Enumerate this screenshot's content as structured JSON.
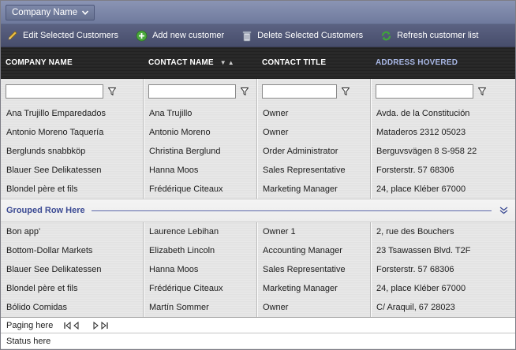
{
  "group_panel": {
    "chip_label": "Company Name"
  },
  "toolbar": {
    "edit_label": "Edit Selected Customers",
    "add_label": "Add new customer",
    "delete_label": "Delete Selected Customers",
    "refresh_label": "Refresh customer list"
  },
  "columns": [
    "COMPANY NAME",
    "CONTACT NAME",
    "CONTACT TITLE",
    "ADDRESS HOVERED"
  ],
  "filters": {
    "company": "",
    "contact": "",
    "title": "",
    "address": ""
  },
  "rows_top": [
    [
      "Ana Trujillo Emparedados",
      "Ana Trujillo",
      "Owner",
      "Avda. de la Constitución"
    ],
    [
      "Antonio Moreno Taquería",
      "Antonio Moreno",
      "Owner",
      "Mataderos 2312 05023"
    ],
    [
      "Berglunds snabbköp",
      "Christina Berglund",
      "Order Administrator",
      "Berguvsvägen 8 S-958 22"
    ],
    [
      "Blauer See Delikatessen",
      "Hanna Moos",
      "Sales Representative",
      "Forsterstr. 57 68306"
    ],
    [
      "Blondel père et fils",
      "Frédérique Citeaux",
      "Marketing Manager",
      "24, place Kléber 67000"
    ]
  ],
  "group_row": {
    "label": "Grouped Row Here"
  },
  "rows_bottom": [
    [
      "Bon app'",
      "Laurence Lebihan",
      "Owner 1",
      "2, rue des Bouchers"
    ],
    [
      "Bottom-Dollar Markets",
      "Elizabeth Lincoln",
      "Accounting Manager",
      "23 Tsawassen Blvd. T2F"
    ],
    [
      "Blauer See Delikatessen",
      "Hanna Moos",
      "Sales Representative",
      "Forsterstr. 57 68306"
    ],
    [
      "Blondel père et fils",
      "Frédérique Citeaux",
      "Marketing Manager",
      "24, place Kléber 67000"
    ],
    [
      "Bólido Comidas",
      "Martín Sommer",
      "Owner",
      "C/ Araquil, 67 28023"
    ]
  ],
  "pager": {
    "label": "Paging here"
  },
  "status": {
    "text": "Status here"
  },
  "colors": {
    "hovered_header": "#a9b8e6",
    "group_label": "#3b4a93",
    "toolbar_bg": "#474d6b"
  },
  "icons": [
    "chevron-down-icon",
    "pencil-icon",
    "add-icon",
    "delete-icon",
    "refresh-icon",
    "sort-desc-icon",
    "sort-asc-icon",
    "filter-icon",
    "expand-chevron-icon",
    "first-page-icon",
    "prev-page-icon",
    "next-page-icon",
    "last-page-icon"
  ]
}
